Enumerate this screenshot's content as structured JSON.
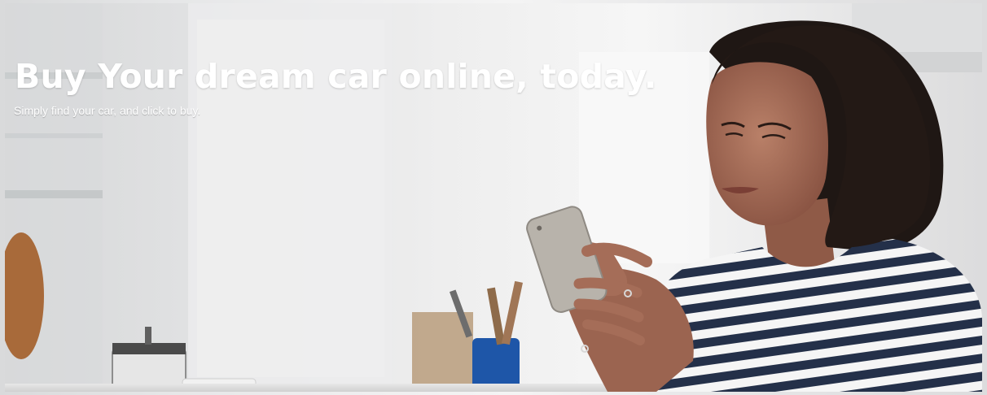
{
  "hero": {
    "heading": "Buy Your dream car online, today.",
    "subheading": "Simply find your car, and click to buy."
  },
  "colors": {
    "background": "#eeeeef",
    "text": "#ffffff",
    "hair": "#1f1714",
    "skin": "#a56d58",
    "shirt_stripe": "#253049",
    "phone": "#b8b3ab"
  }
}
